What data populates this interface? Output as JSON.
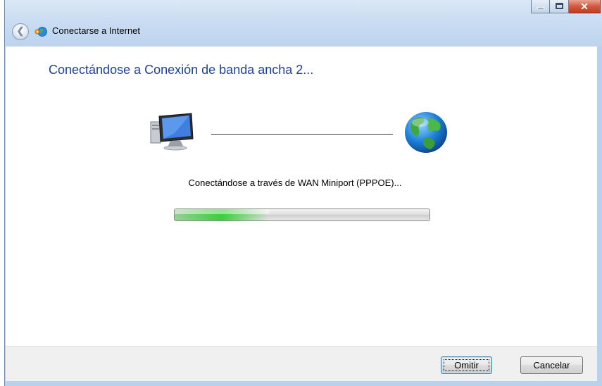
{
  "window": {
    "title": "Conectarse a Internet",
    "close_glyph": "✕",
    "back_glyph": "❮"
  },
  "main": {
    "heading": "Conectándose a Conexión de banda ancha 2...",
    "status": "Conectándose a través de WAN Miniport (PPPOE)...",
    "progress_fraction": 0.37
  },
  "footer": {
    "skip_label": "Omitir",
    "cancel_label": "Cancelar"
  },
  "colors": {
    "heading": "#1e3f9e",
    "progress_green": "#3bcf3b",
    "titlebar": "#c9dcf2"
  },
  "icons": [
    "back-arrow-icon",
    "network-globe-icon",
    "computer-icon",
    "internet-globe-icon",
    "minimize-icon",
    "maximize-icon",
    "close-icon"
  ]
}
